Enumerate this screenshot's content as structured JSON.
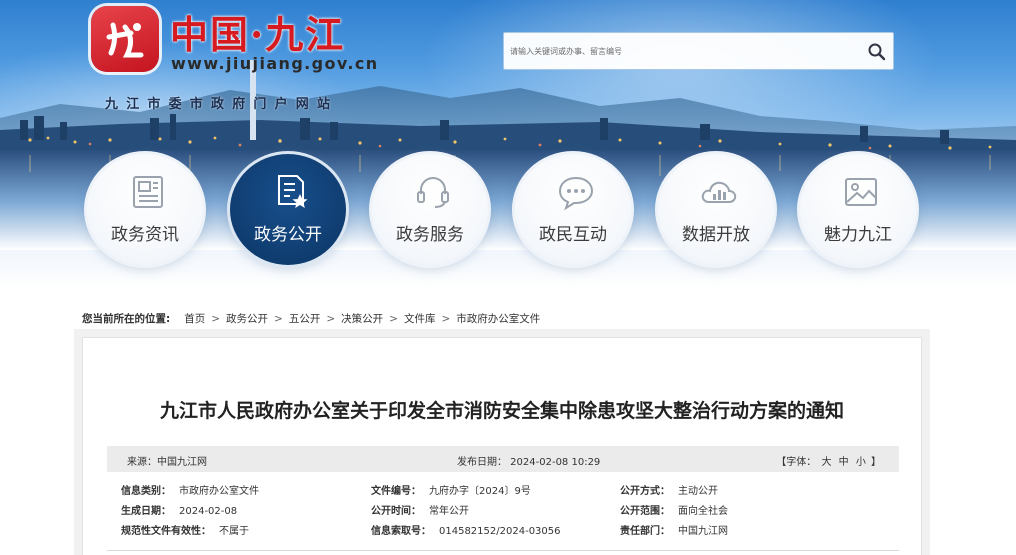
{
  "header": {
    "logo_title": "中国·九江",
    "logo_domain": "www.jiujiang.gov.cn",
    "logo_subtitle": "九江市委市政府门户网站",
    "search_placeholder": "请输入关键词或办事、留言编号"
  },
  "nav": [
    {
      "label": "政务资讯",
      "icon": "newspaper-icon",
      "active": false
    },
    {
      "label": "政务公开",
      "icon": "document-star-icon",
      "active": true
    },
    {
      "label": "政务服务",
      "icon": "headset-icon",
      "active": false
    },
    {
      "label": "政民互动",
      "icon": "chat-bubble-icon",
      "active": false
    },
    {
      "label": "数据开放",
      "icon": "cloud-chart-icon",
      "active": false
    },
    {
      "label": "魅力九江",
      "icon": "picture-icon",
      "active": false
    }
  ],
  "breadcrumb": {
    "prefix": "您当前所在的位置:",
    "items": [
      "首页",
      "政务公开",
      "五公开",
      "决策公开",
      "文件库",
      "市政府办公室文件"
    ]
  },
  "article": {
    "title": "九江市人民政府办公室关于印发全市消防安全集中除患攻坚大整治行动方案的通知",
    "source": "来源：中国九江网",
    "published": "发布日期：  2024-02-08 10:29",
    "fontsize_prefix": "【字体：",
    "fontsize_options": [
      "大",
      "中",
      "小"
    ],
    "fontsize_suffix": "】",
    "info": [
      [
        {
          "key": "信息类别：",
          "value": "市政府办公室文件"
        },
        {
          "key": "文件编号：",
          "value": "九府办字〔2024〕9号"
        },
        {
          "key": "公开方式：",
          "value": "主动公开"
        }
      ],
      [
        {
          "key": "生成日期：",
          "value": "2024-02-08"
        },
        {
          "key": "公开时间：",
          "value": "常年公开"
        },
        {
          "key": "公开范围：",
          "value": "面向全社会"
        }
      ],
      [
        {
          "key": "规范性文件有效性：",
          "value": "不属于"
        },
        {
          "key": "信息索取号：",
          "value": "014582152/2024-03056"
        },
        {
          "key": "责任部门：",
          "value": "中国九江网"
        }
      ]
    ]
  },
  "colors": {
    "brand_red": "#d61a1f",
    "nav_active_blue": "#0e3a6c",
    "sky_top": "#2f7fd0"
  }
}
